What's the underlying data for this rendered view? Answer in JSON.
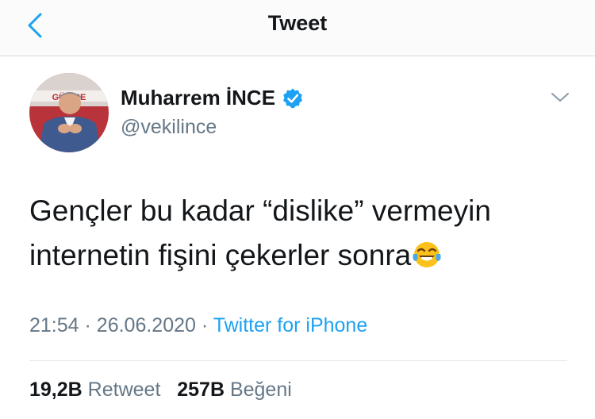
{
  "nav": {
    "title": "Tweet",
    "back_icon": "chevron-left-icon"
  },
  "author": {
    "name": "Muharrem İNCE",
    "handle": "@vekilince",
    "verified": true,
    "avatar_sign_text": "GÜ   NCE"
  },
  "tweet": {
    "text_line1": "Gençler bu kadar “dislike” vermeyin",
    "text_line2": "internetin fişini çekerler sonra",
    "emoji": "face-with-tears-of-joy-icon",
    "time": "21:54",
    "date": "26.06.2020",
    "separator": "·",
    "source": "Twitter for iPhone"
  },
  "stats": {
    "retweet_count": "19,2B",
    "retweet_label": "Retweet",
    "like_count": "257B",
    "like_label": "Beğeni"
  },
  "colors": {
    "accent": "#1da1f2",
    "secondary_text": "#657786",
    "primary_text": "#14171a"
  }
}
